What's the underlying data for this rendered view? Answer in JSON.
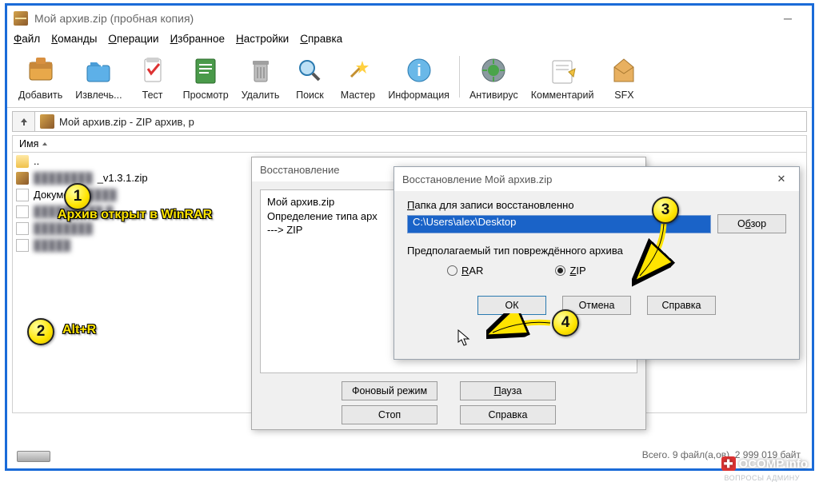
{
  "window": {
    "title": "Мой архив.zip (пробная копия)"
  },
  "menu": {
    "file": "Файл",
    "commands": "Команды",
    "operations": "Операции",
    "favorites": "Избранное",
    "settings": "Настройки",
    "help": "Справка"
  },
  "toolbar": {
    "add": "Добавить",
    "extract": "Извлечь...",
    "test": "Тест",
    "view": "Просмотр",
    "delete": "Удалить",
    "find": "Поиск",
    "wizard": "Мастер",
    "info": "Информация",
    "antivirus": "Антивирус",
    "comment": "Комментарий",
    "sfx": "SFX"
  },
  "address": {
    "path": "Мой архив.zip - ZIP архив, р"
  },
  "columns": {
    "name": "Имя"
  },
  "files": {
    "updir": "..",
    "row2_suffix": "_v1.3.1.zip",
    "row3": "Докумен",
    "blur_a": "████████",
    "blur_b": "███████ ██ █",
    "blur_c": "████████",
    "blur_d": "█████"
  },
  "dlg1": {
    "title": "Восстановление",
    "log1": "Мой архив.zip",
    "log2": "Определение типа арх",
    "log3": "---> ZIP",
    "btn_bg": "Фоновый режим",
    "btn_pause": "Пауза",
    "btn_stop": "Стоп",
    "btn_help": "Справка"
  },
  "dlg2": {
    "title": "Восстановление Мой архив.zip",
    "lbl_folder": "Папка для записи восстановленно",
    "path": "C:\\Users\\alex\\Desktop",
    "browse": "Обзор",
    "lbl_type": "Предполагаемый тип повреждённого архива",
    "rar": "RAR",
    "zip": "ZIP",
    "ok": "ОК",
    "cancel": "Отмена",
    "help": "Справка"
  },
  "anno": {
    "b1": "1",
    "b2": "2",
    "b3": "3",
    "b4": "4",
    "t1": "Архив открыт в WinRAR",
    "t2": "Alt+R"
  },
  "status": {
    "right": "Всего. 9 файл(а,ов), 2 999 019 байт"
  },
  "watermark": {
    "text": "OCOMP.info",
    "sub": "ВОПРОСЫ АДМИНУ"
  }
}
